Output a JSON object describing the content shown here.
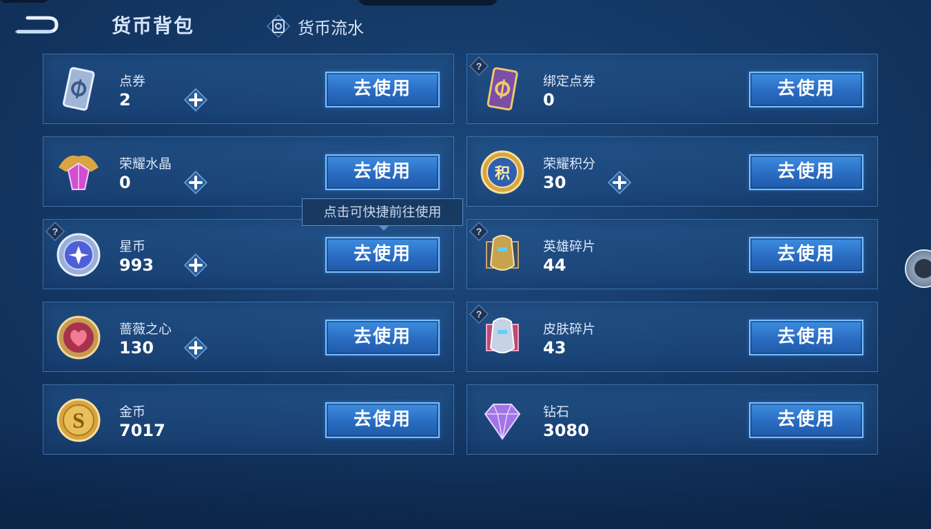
{
  "header": {
    "title": "货币背包",
    "flow_label": "货币流水"
  },
  "tooltip": "点击可快捷前往使用",
  "use_label": "去使用",
  "currencies": [
    {
      "name": "点券",
      "value": "2",
      "icon": "coupon-icon",
      "has_plus": true,
      "has_help": false
    },
    {
      "name": "绑定点券",
      "value": "0",
      "icon": "bound-coupon-icon",
      "has_plus": false,
      "has_help": true
    },
    {
      "name": "荣耀水晶",
      "value": "0",
      "icon": "glory-crystal-icon",
      "has_plus": true,
      "has_help": false
    },
    {
      "name": "荣耀积分",
      "value": "30",
      "icon": "glory-points-icon",
      "has_plus": true,
      "has_help": false
    },
    {
      "name": "星币",
      "value": "993",
      "icon": "star-coin-icon",
      "has_plus": true,
      "has_help": true
    },
    {
      "name": "英雄碎片",
      "value": "44",
      "icon": "hero-shard-icon",
      "has_plus": false,
      "has_help": true
    },
    {
      "name": "蔷薇之心",
      "value": "130",
      "icon": "rose-heart-icon",
      "has_plus": true,
      "has_help": false
    },
    {
      "name": "皮肤碎片",
      "value": "43",
      "icon": "skin-shard-icon",
      "has_plus": false,
      "has_help": true
    },
    {
      "name": "金币",
      "value": "7017",
      "icon": "gold-coin-icon",
      "has_plus": false,
      "has_help": false
    },
    {
      "name": "钻石",
      "value": "3080",
      "icon": "diamond-icon",
      "has_plus": false,
      "has_help": false
    }
  ],
  "colors": {
    "button": "#2a6cc2",
    "button_border": "#7cc0ff",
    "card_border": "#5a96d2"
  }
}
